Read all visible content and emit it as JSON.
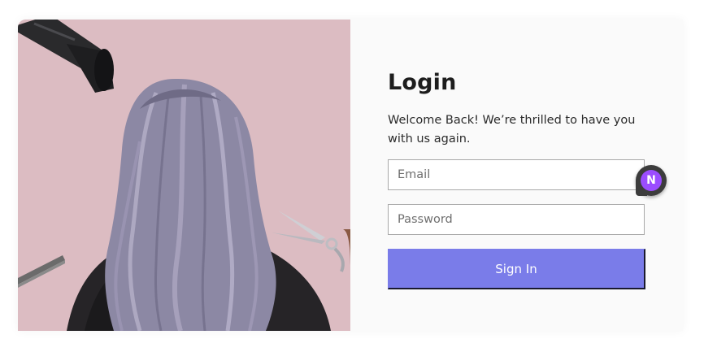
{
  "login": {
    "title": "Login",
    "welcome_text": "Welcome Back! We’re thrilled to have you with us again.",
    "email_placeholder": "Email",
    "password_placeholder": "Password",
    "sign_in_label": "Sign In"
  },
  "floating_badge": {
    "letter": "N"
  },
  "colors": {
    "hero_background": "#dcbcc2",
    "button_accent": "#7a7ce9",
    "badge_accent": "#9b4dff"
  },
  "hero": {
    "icons": [
      "hair-dryer-icon",
      "comb-icon",
      "scissors-icon"
    ]
  }
}
